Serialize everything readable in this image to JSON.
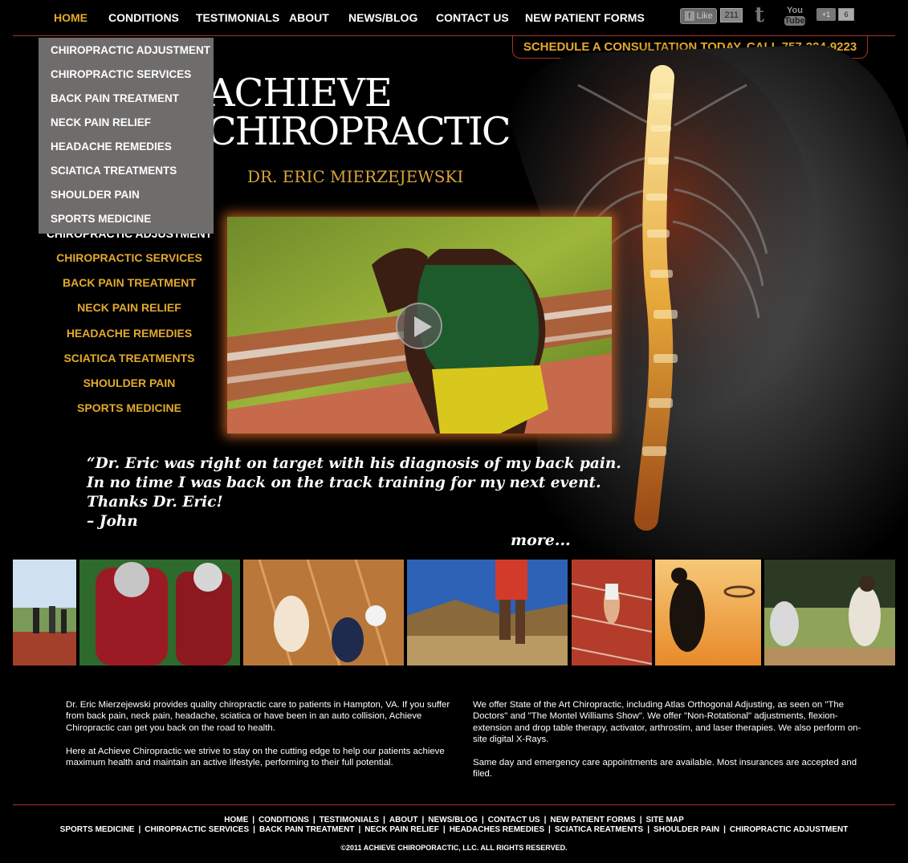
{
  "nav": {
    "items": [
      "HOME",
      "CONDITIONS",
      "TESTIMONIALS",
      "ABOUT",
      "NEWS/BLOG",
      "CONTACT US",
      "NEW PATIENT FORMS"
    ],
    "active": "HOME",
    "active_color": "#e3a92c"
  },
  "social": {
    "fb_like_label": "Like",
    "fb_like_count": "211",
    "youtube_you": "You",
    "youtube_tube": "Tube",
    "gplus_label": "+1",
    "gplus_count": "6"
  },
  "consult_banner": "SCHEDULE A CONSULTATION TODAY, CALL 757-224-9223",
  "logo": {
    "line1": "ACHIEVE",
    "line2": "CHIROPRACTIC",
    "doctor": "DR. ERIC MIERZEJEWSKI"
  },
  "dropdown": {
    "items": [
      "CHIROPRACTIC ADJUSTMENT",
      "CHIROPRACTIC SERVICES",
      "BACK PAIN TREATMENT",
      "NECK PAIN RELIEF",
      "HEADACHE REMEDIES",
      "SCIATICA TREATMENTS",
      "SHOULDER PAIN",
      "SPORTS MEDICINE"
    ]
  },
  "side_menu": {
    "items": [
      "CHIROPRACTIC ADJUSTMENT",
      "CHIROPRACTIC SERVICES",
      "BACK PAIN TREATMENT",
      "NECK PAIN RELIEF",
      "HEADACHE REMEDIES",
      "SCIATICA TREATMENTS",
      "SHOULDER PAIN",
      "SPORTS MEDICINE"
    ]
  },
  "testimonial": {
    "lines": [
      "“Dr. Eric was right on target with his diagnosis of my back pain.",
      "In no time I was back on the track training for my next event.",
      "Thanks Dr. Eric!",
      "– John"
    ],
    "more": "more..."
  },
  "photo_strip": [
    "track-sprinters",
    "football-players",
    "volleyball-players",
    "runner-desert",
    "sprinter-woman",
    "basketball-dunk-sunset",
    "baseball-batter"
  ],
  "about": {
    "left": [
      "Dr. Eric Mierzejewski provides quality chiropractic care to patients in Hampton, VA. If you suffer from back pain, neck pain, headache, sciatica or have been in an auto collision, Achieve Chiropractic can get you back on the road to health.",
      "Here at Achieve Chiropractic we strive to stay on the cutting edge to help our patients achieve maximum health and maintain an active lifestyle, performing to their full potential."
    ],
    "right": [
      "We offer State of the Art Chiropractic, including Atlas Orthogonal Adjusting, as seen on \"The Doctors\" and \"The Montel Williams Show\".  We offer \"Non-Rotational\" adjustments, flexion-extension and drop table therapy, activator, arthrostim, and laser therapies.  We also perform on-site digital X-Rays.",
      "Same day and emergency care appointments are available.  Most insurances are accepted and filed."
    ]
  },
  "footer": {
    "row1": [
      "HOME",
      "CONDITIONS",
      "TESTIMONIALS",
      "ABOUT",
      "NEWS/BLOG",
      "CONTACT US",
      "NEW PATIENT FORMS",
      "SITE MAP"
    ],
    "row2": [
      "SPORTS MEDICINE",
      "CHIROPRACTIC SERVICES",
      "BACK PAIN TREATMENT",
      "NECK PAIN RELIEF",
      "HEADACHES REMEDIES",
      "SCIATICA REATMENTS",
      "SHOULDER PAIN",
      "CHIROPRACTIC ADJUSTMENT"
    ],
    "separator": "|",
    "copyright": "©2011 ACHIEVE CHIROPORACTIC, LLC. ALL RIGHTS RESERVED."
  },
  "colors": {
    "accent_gold": "#e3a92c",
    "rule_red": "#a8332c",
    "dropdown_bg": "#6f6d6c",
    "background": "#000000"
  }
}
